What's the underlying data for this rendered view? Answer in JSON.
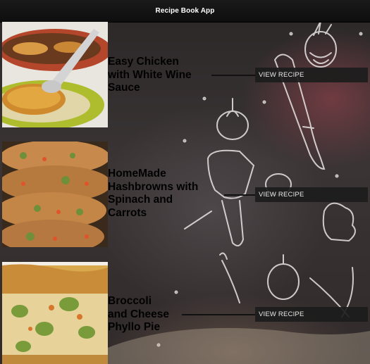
{
  "app": {
    "title": "Recipe Book App"
  },
  "recipes": [
    {
      "title": "Easy Chicken with White Wine Sauce",
      "lines": [
        "Easy Chicken",
        "with White Wine",
        "Sauce"
      ],
      "button": "VIEW RECIPE"
    },
    {
      "title": "HomeMade Hashbrowns with Spinach and Carrots",
      "lines": [
        "HomeMade",
        "Hashbrowns with",
        "Spinach and",
        "Carrots"
      ],
      "button": "VIEW RECIPE"
    },
    {
      "title": "Broccoli and Cheese Phyllo Pie",
      "lines": [
        "Broccoli",
        "and Cheese",
        "Phyllo Pie"
      ],
      "button": "VIEW RECIPE"
    }
  ],
  "colors": {
    "header_bg": "#111111",
    "button_bg": "#1c1c1c",
    "button_text": "#e8e8e8"
  }
}
